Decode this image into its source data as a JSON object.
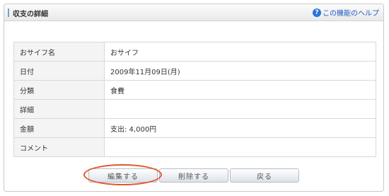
{
  "panel": {
    "title": "収支の詳細",
    "help_link": "この機能のヘルプ",
    "help_icon": "question-circle-icon"
  },
  "details": {
    "rows": [
      {
        "label": "おサイフ名",
        "value": "おサイフ"
      },
      {
        "label": "日付",
        "value": "2009年11月09日(月)"
      },
      {
        "label": "分類",
        "value": "食費"
      },
      {
        "label": "詳細",
        "value": ""
      },
      {
        "label": "金額",
        "value": "支出: 4,000円"
      },
      {
        "label": "コメント",
        "value": ""
      }
    ]
  },
  "actions": {
    "edit_label": "編集する",
    "delete_label": "削除する",
    "back_label": "戻る"
  },
  "colors": {
    "highlight_ring": "#e0562d",
    "help_link": "#1f58c7",
    "header_accent": "#7d9fd3"
  }
}
